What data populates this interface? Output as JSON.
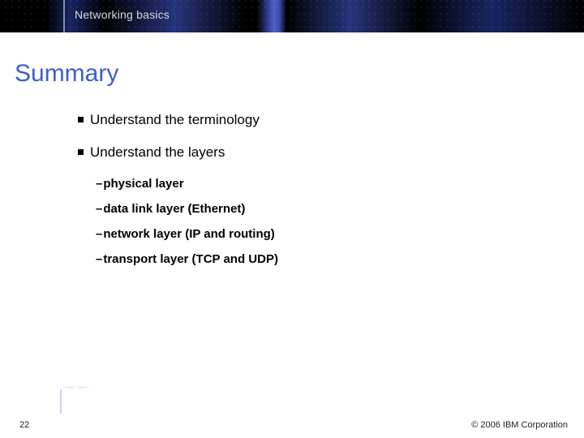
{
  "header": {
    "course_title": "Networking basics"
  },
  "title": "Summary",
  "bullets": [
    {
      "text": "Understand the terminology",
      "subs": []
    },
    {
      "text": "Understand the layers",
      "subs": [
        "physical layer",
        "data link layer (Ethernet)",
        "network layer (IP and routing)",
        "transport layer (TCP and UDP)"
      ]
    }
  ],
  "footer": {
    "page_number": "22",
    "copyright": "© 2006 IBM Corporation"
  }
}
